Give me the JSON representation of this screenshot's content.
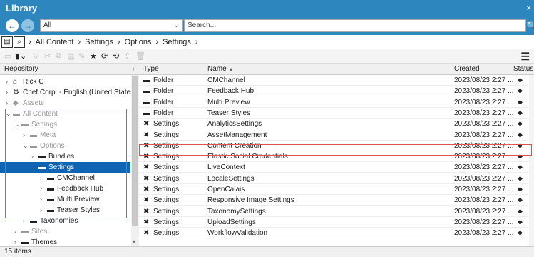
{
  "window": {
    "title": "Library",
    "close": "×"
  },
  "address": {
    "back": "←",
    "forward": "→",
    "select_value": "All",
    "search_placeholder": "Search..."
  },
  "breadcrumb": [
    "All Content",
    "Settings",
    "Options",
    "Settings"
  ],
  "tree": {
    "header": "Repository",
    "nodes": [
      {
        "label": "Rick C",
        "depth": 0,
        "chev": "›",
        "icon": "home-icon"
      },
      {
        "label": "Chef Corp. - English (United States)",
        "depth": 0,
        "chev": "›",
        "icon": "site-icon"
      },
      {
        "label": "Assets",
        "depth": 0,
        "chev": "›",
        "icon": "assets-icon",
        "gray": true
      },
      {
        "label": "All Content",
        "depth": 0,
        "chev": "⌄",
        "icon": "folder-icon",
        "gray": true
      },
      {
        "label": "Settings",
        "depth": 1,
        "chev": "⌄",
        "icon": "folder-icon",
        "gray": true
      },
      {
        "label": "Meta",
        "depth": 2,
        "chev": "›",
        "icon": "folder-icon",
        "gray": true
      },
      {
        "label": "Options",
        "depth": 2,
        "chev": "⌄",
        "icon": "folder-icon",
        "gray": true
      },
      {
        "label": "Bundles",
        "depth": 3,
        "chev": "›",
        "icon": "folder-icon"
      },
      {
        "label": "Settings",
        "depth": 3,
        "chev": "⌄",
        "icon": "folder-icon",
        "selected": true
      },
      {
        "label": "CMChannel",
        "depth": 4,
        "chev": "›",
        "icon": "folder-icon"
      },
      {
        "label": "Feedback Hub",
        "depth": 4,
        "chev": "›",
        "icon": "folder-icon"
      },
      {
        "label": "Multi Preview",
        "depth": 4,
        "chev": "›",
        "icon": "folder-icon"
      },
      {
        "label": "Teaser Styles",
        "depth": 4,
        "chev": "›",
        "icon": "folder-icon"
      },
      {
        "label": "Taxonomies",
        "depth": 2,
        "chev": "›",
        "icon": "folder-icon"
      },
      {
        "label": "Sites",
        "depth": 1,
        "chev": "›",
        "icon": "folder-icon",
        "gray": true
      },
      {
        "label": "Themes",
        "depth": 1,
        "chev": "›",
        "icon": "folder-icon"
      }
    ]
  },
  "table": {
    "columns": {
      "type": "Type",
      "name": "Name",
      "sort": "▲",
      "created": "Created",
      "status": "Status"
    },
    "rows": [
      {
        "type": "Folder",
        "name": "CMChannel",
        "created": "2023/08/23 2:27 ...",
        "kind": "folder"
      },
      {
        "type": "Folder",
        "name": "Feedback Hub",
        "created": "2023/08/23 2:27 ...",
        "kind": "folder"
      },
      {
        "type": "Folder",
        "name": "Multi Preview",
        "created": "2023/08/23 2:27 ...",
        "kind": "folder"
      },
      {
        "type": "Folder",
        "name": "Teaser Styles",
        "created": "2023/08/23 2:27 ...",
        "kind": "folder"
      },
      {
        "type": "Settings",
        "name": "AnalyticsSettings",
        "created": "2023/08/23 2:27 ...",
        "kind": "settings"
      },
      {
        "type": "Settings",
        "name": "AssetManagement",
        "created": "2023/08/23 2:27 ...",
        "kind": "settings"
      },
      {
        "type": "Settings",
        "name": "Content Creation",
        "created": "2023/08/23 2:27 ...",
        "kind": "settings"
      },
      {
        "type": "Settings",
        "name": "Elastic Social Credentials",
        "created": "2023/08/23 2:27 ...",
        "kind": "settings"
      },
      {
        "type": "Settings",
        "name": "LiveContext",
        "created": "2023/08/23 2:27 ...",
        "kind": "settings"
      },
      {
        "type": "Settings",
        "name": "LocaleSettings",
        "created": "2023/08/23 2:27 ...",
        "kind": "settings"
      },
      {
        "type": "Settings",
        "name": "OpenCalais",
        "created": "2023/08/23 2:27 ...",
        "kind": "settings"
      },
      {
        "type": "Settings",
        "name": "Responsive Image Settings",
        "created": "2023/08/23 2:27 ...",
        "kind": "settings"
      },
      {
        "type": "Settings",
        "name": "TaxonomySettings",
        "created": "2023/08/23 2:27 ...",
        "kind": "settings"
      },
      {
        "type": "Settings",
        "name": "UploadSettings",
        "created": "2023/08/23 2:27 ...",
        "kind": "settings"
      },
      {
        "type": "Settings",
        "name": "WorkflowValidation",
        "created": "2023/08/23 2:27 ...",
        "kind": "settings"
      }
    ]
  },
  "status_text": "15 items"
}
